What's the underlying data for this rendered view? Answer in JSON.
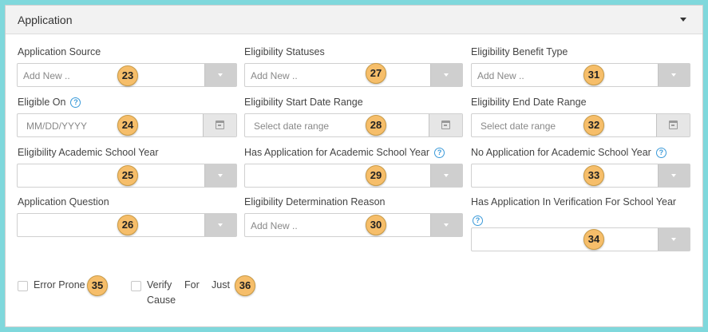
{
  "panel": {
    "title": "Application"
  },
  "fields": {
    "application_source": {
      "label": "Application Source",
      "placeholder": "Add New ..",
      "badge": "23"
    },
    "eligible_on": {
      "label": "Eligible On",
      "placeholder": "MM/DD/YYYY",
      "badge": "24"
    },
    "eligibility_academic_school_year": {
      "label": "Eligibility Academic School Year",
      "placeholder": "",
      "badge": "25"
    },
    "application_question": {
      "label": "Application Question",
      "placeholder": "",
      "badge": "26"
    },
    "eligibility_statuses": {
      "label": "Eligibility Statuses",
      "placeholder": "Add New ..",
      "badge": "27"
    },
    "eligibility_start_date_range": {
      "label": "Eligibility Start Date Range",
      "placeholder": "Select date range",
      "badge": "28"
    },
    "has_application_for_academic_school_year": {
      "label": "Has Application for Academic School Year",
      "placeholder": "",
      "badge": "29"
    },
    "eligibility_determination_reason": {
      "label": "Eligibility Determination Reason",
      "placeholder": "Add New ..",
      "badge": "30"
    },
    "eligibility_benefit_type": {
      "label": "Eligibility Benefit Type",
      "placeholder": "Add New ..",
      "badge": "31"
    },
    "eligibility_end_date_range": {
      "label": "Eligibility End Date Range",
      "placeholder": "Select date range",
      "badge": "32"
    },
    "no_application_for_academic_school_year": {
      "label": "No Application for Academic School Year",
      "placeholder": "",
      "badge": "33"
    },
    "has_application_in_verification": {
      "label": "Has Application In Verification For School Year",
      "placeholder": "",
      "badge": "34"
    }
  },
  "checkboxes": {
    "error_prone": {
      "label": "Error Prone",
      "badge": "35",
      "checked": false
    },
    "verify_for_just_cause": {
      "label_line1": "Verify",
      "label_for": "For",
      "label_just": "Just",
      "label_line2": "Cause",
      "badge": "36",
      "checked": false
    }
  },
  "colors": {
    "background": "#7fd8dc",
    "badge": "#f6be6a",
    "help": "#3b9ad9",
    "addon": "#cfcfcf"
  },
  "icons": {
    "help": "question-circle-icon",
    "dropdown": "chevron-down-icon",
    "date": "calendar-icon",
    "panel_toggle": "caret-down-icon"
  }
}
